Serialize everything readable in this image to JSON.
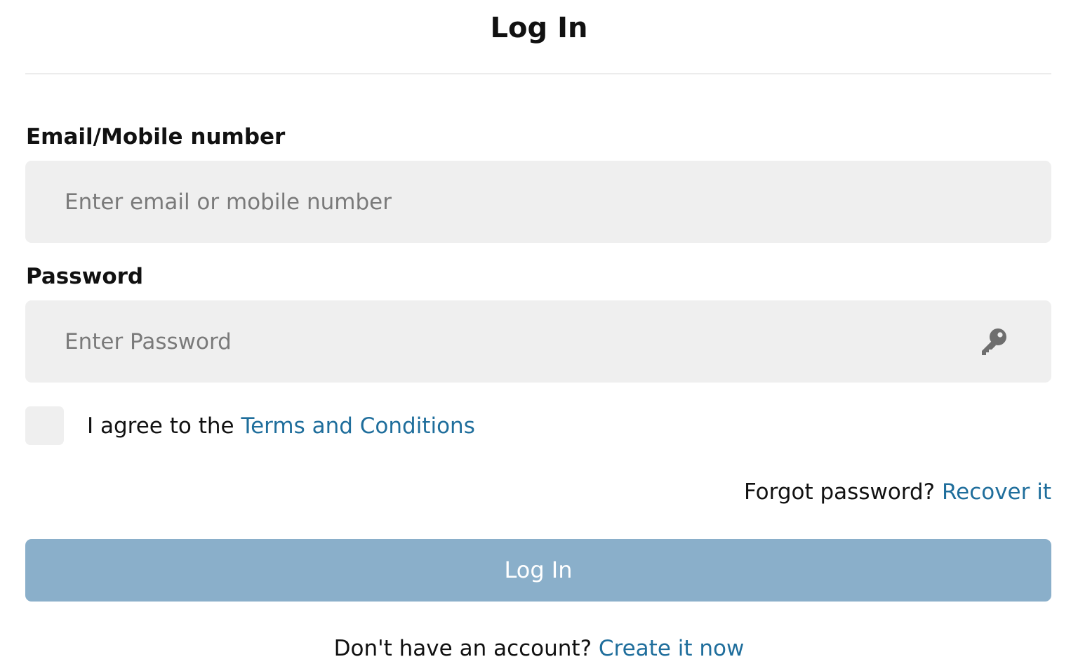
{
  "header": {
    "title": "Log In"
  },
  "form": {
    "email": {
      "label": "Email/Mobile number",
      "placeholder": "Enter email or mobile number",
      "value": ""
    },
    "password": {
      "label": "Password",
      "placeholder": "Enter Password",
      "value": "",
      "icon": "key-icon"
    },
    "terms": {
      "checked": false,
      "prefix": "I agree to the ",
      "link_text": "Terms and Conditions"
    },
    "forgot": {
      "prefix": "Forgot password? ",
      "link_text": "Recover it"
    },
    "submit_label": "Log In"
  },
  "footer": {
    "prefix": "Don't have an account? ",
    "link_text": "Create it now"
  },
  "colors": {
    "link": "#1f6e9c",
    "button_disabled": "#8aafca",
    "input_background": "#efefef"
  }
}
